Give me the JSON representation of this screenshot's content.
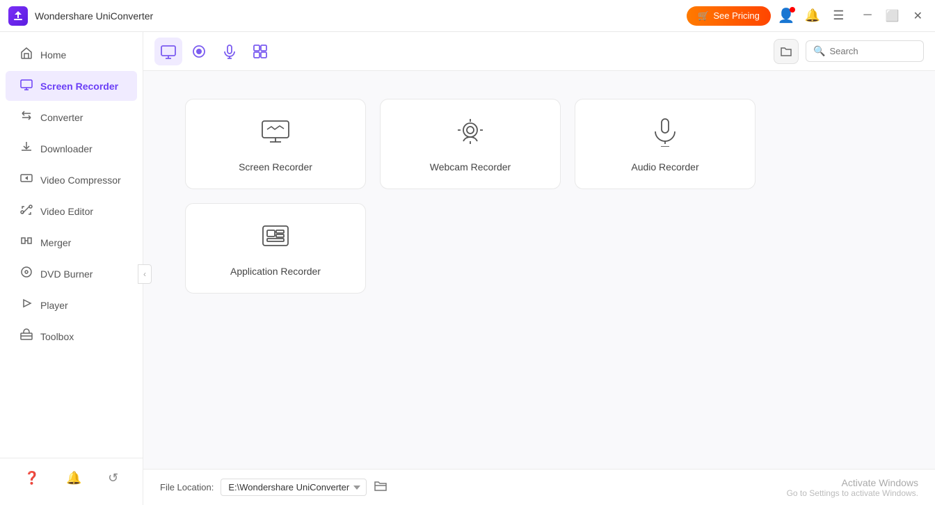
{
  "titlebar": {
    "app_name": "Wondershare UniConverter",
    "see_pricing": "See Pricing"
  },
  "sidebar": {
    "items": [
      {
        "id": "home",
        "label": "Home",
        "icon": "🏠"
      },
      {
        "id": "converter",
        "label": "Converter",
        "icon": "🔄"
      },
      {
        "id": "downloader",
        "label": "Downloader",
        "icon": "⬇"
      },
      {
        "id": "video-compressor",
        "label": "Video Compressor",
        "icon": "🗜"
      },
      {
        "id": "video-editor",
        "label": "Video Editor",
        "icon": "✂"
      },
      {
        "id": "merger",
        "label": "Merger",
        "icon": "🔗"
      },
      {
        "id": "screen-recorder",
        "label": "Screen Recorder",
        "icon": "⏺",
        "active": true
      },
      {
        "id": "dvd-burner",
        "label": "DVD Burner",
        "icon": "💿"
      },
      {
        "id": "player",
        "label": "Player",
        "icon": "▶"
      },
      {
        "id": "toolbox",
        "label": "Toolbox",
        "icon": "🧰"
      }
    ],
    "bottom_icons": [
      "❓",
      "🔔",
      "↺"
    ]
  },
  "toolbar": {
    "search_placeholder": "Search"
  },
  "recorders": [
    {
      "id": "screen-recorder",
      "label": "Screen Recorder"
    },
    {
      "id": "webcam-recorder",
      "label": "Webcam Recorder"
    },
    {
      "id": "audio-recorder",
      "label": "Audio Recorder"
    },
    {
      "id": "application-recorder",
      "label": "Application Recorder"
    }
  ],
  "footer": {
    "file_location_label": "File Location:",
    "file_location_value": "E:\\Wondershare UniConverter",
    "activate_windows_title": "Activate Windows",
    "activate_windows_sub": "Go to Settings to activate Windows."
  }
}
